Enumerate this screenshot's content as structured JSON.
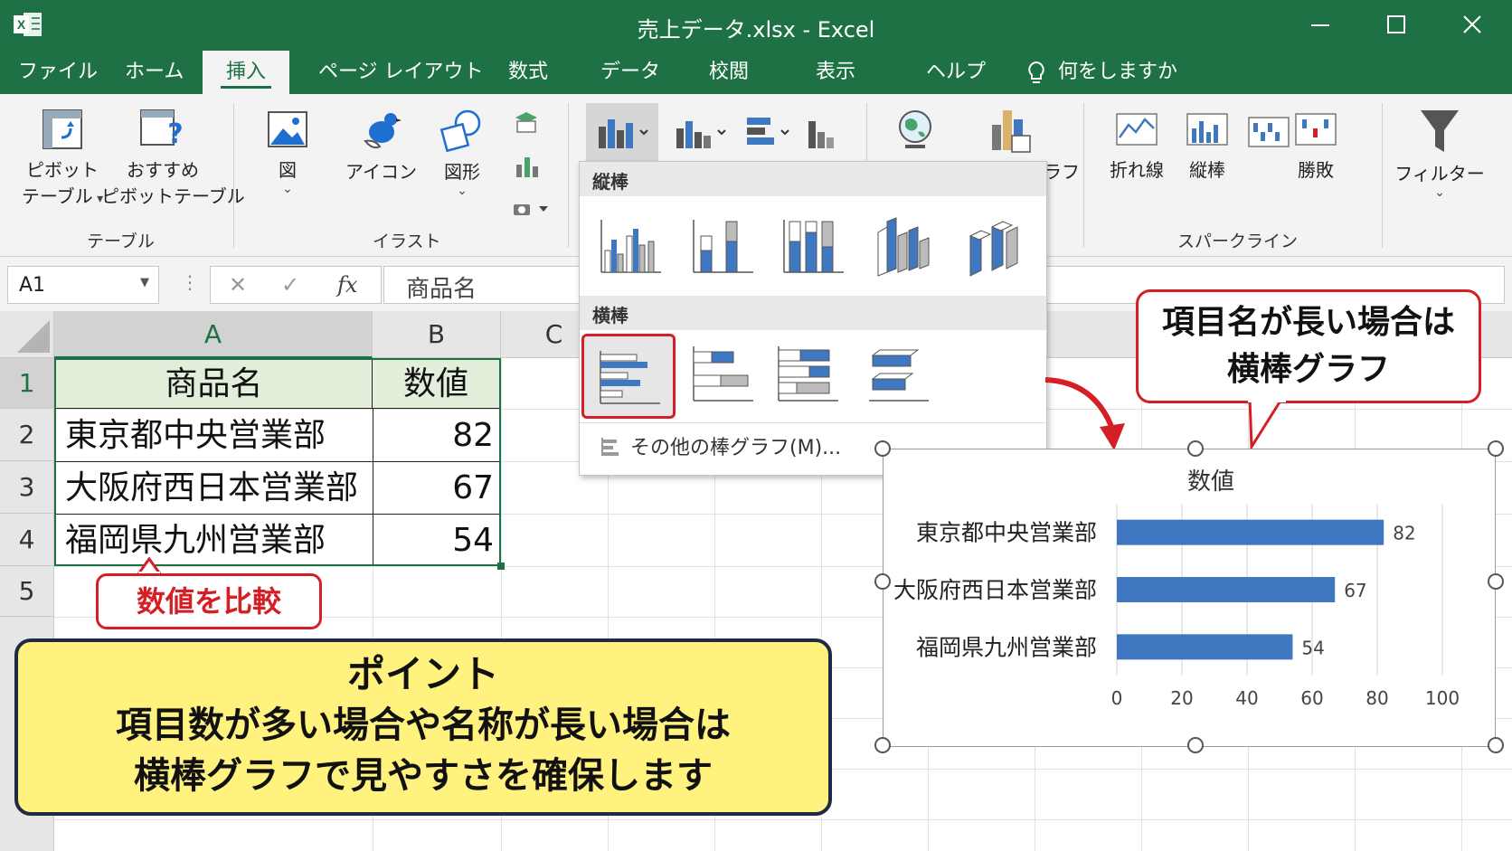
{
  "window": {
    "title": "売上データ.xlsx  -  Excel"
  },
  "tabs": [
    {
      "label": "ファイル"
    },
    {
      "label": "ホーム"
    },
    {
      "label": "挿入"
    },
    {
      "label": "ページ レイアウト"
    },
    {
      "label": "数式"
    },
    {
      "label": "データ"
    },
    {
      "label": "校閲"
    },
    {
      "label": "表示"
    },
    {
      "label": "ヘルプ"
    },
    {
      "label": "何をしますか"
    }
  ],
  "ribbon": {
    "pivot_table": [
      "ピボット",
      "テーブル"
    ],
    "recommended_pivot": [
      "おすすめ",
      "ピボットテーブル"
    ],
    "group_table": "テーブル",
    "picture": "図",
    "icon": "アイコン",
    "shape": "図形",
    "group_illust": "イラスト",
    "map": "マップ",
    "pivot_chart": "ピボットグラフ",
    "sparkline_line": "折れ線",
    "sparkline_column": "縦棒",
    "sparkline_winloss": "勝敗",
    "group_sparkline": "スパークライン",
    "filter": "フィルター"
  },
  "formula_bar": {
    "name_box": "A1",
    "fx": "fx",
    "value": "商品名"
  },
  "columns": [
    "A",
    "B",
    "C"
  ],
  "rows": [
    "1",
    "2",
    "3",
    "4",
    "5"
  ],
  "table": {
    "headers": [
      "商品名",
      "数値"
    ],
    "rows": [
      {
        "name": "東京都中央営業部",
        "value": "82"
      },
      {
        "name": "大阪府西日本営業部",
        "value": "67"
      },
      {
        "name": "福岡県九州営業部",
        "value": "54"
      }
    ]
  },
  "dropdown": {
    "section_vertical": "縦棒",
    "section_horizontal": "横棒",
    "more": "その他の棒グラフ(M)..."
  },
  "chart_data": {
    "type": "bar",
    "orientation": "horizontal",
    "title": "数値",
    "categories": [
      "東京都中央営業部",
      "大阪府西日本営業部",
      "福岡県九州営業部"
    ],
    "values": [
      82,
      67,
      54
    ],
    "xlim": [
      0,
      100
    ],
    "xticks": [
      "0",
      "20",
      "40",
      "60",
      "80",
      "100"
    ],
    "bar_color": "#3f78c0",
    "grid": true,
    "legend": "none"
  },
  "callouts": {
    "compare": "数値を比較",
    "long_names": [
      "項目名が長い場合は",
      "横棒グラフ"
    ],
    "point_title": "ポイント",
    "point_lines": [
      "項目数が多い場合や名称が長い場合は",
      "横棒グラフで見やすさを確保します"
    ]
  },
  "colors": {
    "excel_green": "#1e7145",
    "callout_red": "#d41f25",
    "point_yellow": "#fff27f"
  }
}
